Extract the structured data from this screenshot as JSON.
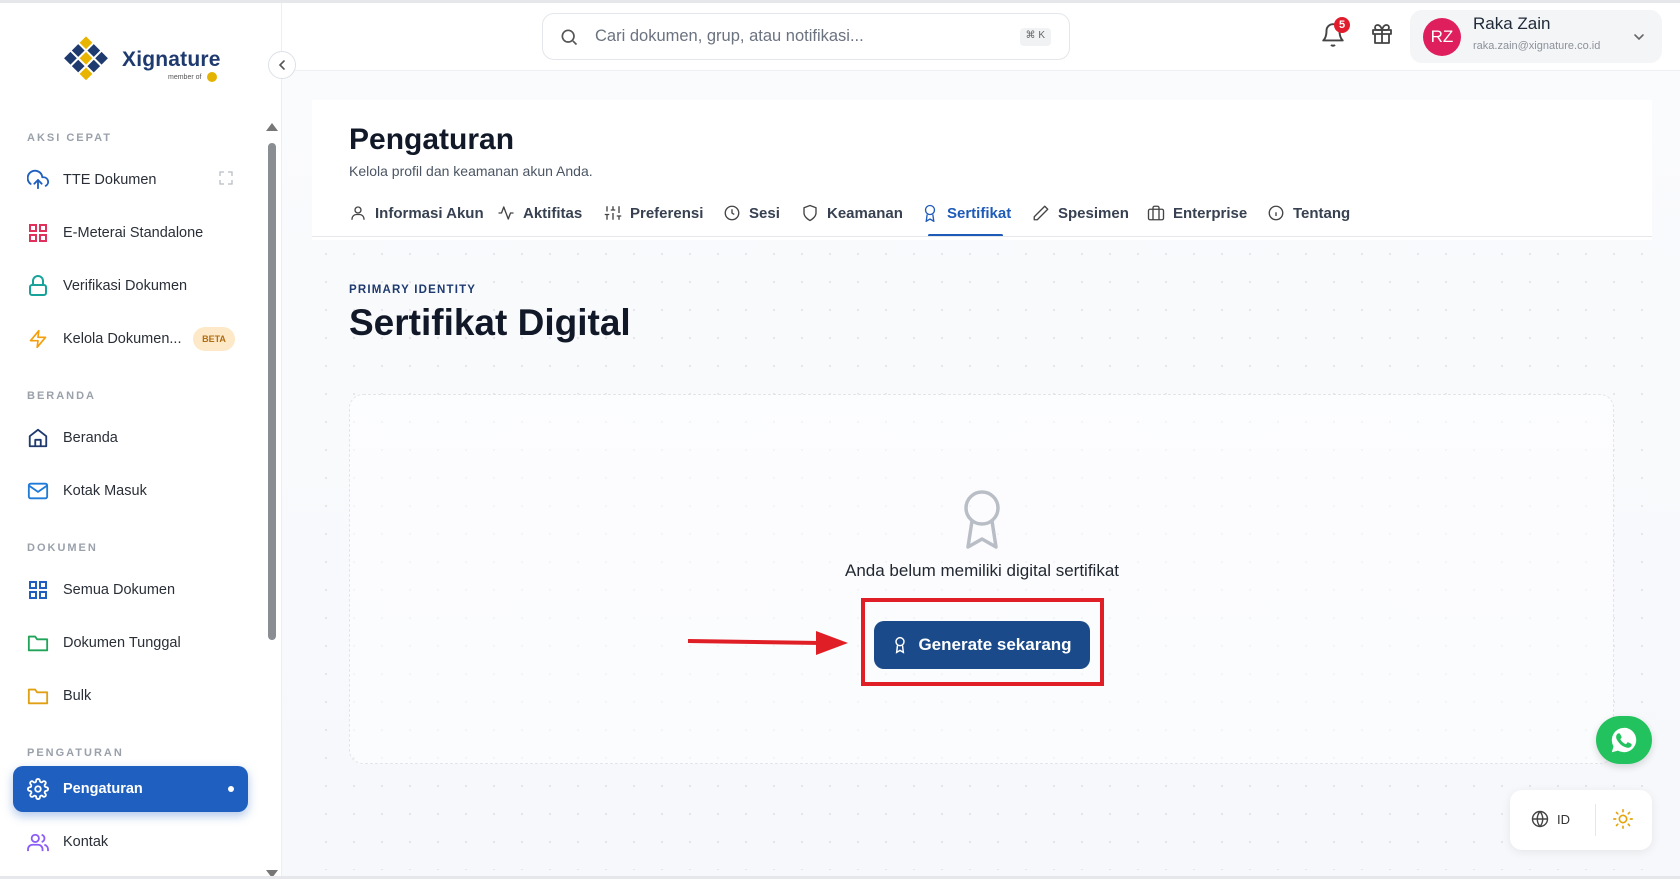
{
  "app": {
    "logo_text": "Xignature",
    "logo_member": "member of"
  },
  "sidebar": {
    "sections": [
      {
        "title": "AKSI CEPAT"
      },
      {
        "title": "BERANDA"
      },
      {
        "title": "DOKUMEN"
      },
      {
        "title": "PENGATURAN"
      }
    ],
    "items": [
      {
        "label": "TTE Dokumen",
        "icon": "upload-cloud-icon",
        "color": "#1f5fbf"
      },
      {
        "label": "E-Meterai Standalone",
        "icon": "grid-icon",
        "color": "#e0315c"
      },
      {
        "label": "Verifikasi Dokumen",
        "icon": "lock-icon",
        "color": "#17a39a"
      },
      {
        "label": "Kelola Dokumen...",
        "icon": "lightning-icon",
        "color": "#f59e0b",
        "badge": "BETA"
      },
      {
        "label": "Beranda",
        "icon": "home-icon",
        "color": "#1e3a6e"
      },
      {
        "label": "Kotak Masuk",
        "icon": "mail-icon",
        "color": "#1f7ad8"
      },
      {
        "label": "Semua Dokumen",
        "icon": "grid-icon",
        "color": "#1f5fbf"
      },
      {
        "label": "Dokumen Tunggal",
        "icon": "folder-icon",
        "color": "#22a35a"
      },
      {
        "label": "Bulk",
        "icon": "folder-icon",
        "color": "#e0a013"
      },
      {
        "label": "Pengaturan",
        "icon": "gear-icon",
        "color": "#ffffff",
        "active": true
      },
      {
        "label": "Kontak",
        "icon": "users-icon",
        "color": "#8b5cf6"
      }
    ]
  },
  "header": {
    "search_placeholder": "Cari dokumen, grup, atau notifikasi...",
    "search_shortcut": "⌘ K",
    "notification_count": "5",
    "user": {
      "initials": "RZ",
      "name": "Raka Zain",
      "email": "raka.zain@xignature.co.id"
    }
  },
  "page": {
    "title": "Pengaturan",
    "subtitle": "Kelola profil dan keamanan akun Anda.",
    "tabs": [
      {
        "label": "Informasi Akun",
        "icon": "user-icon"
      },
      {
        "label": "Aktifitas",
        "icon": "activity-icon"
      },
      {
        "label": "Preferensi",
        "icon": "sliders-icon"
      },
      {
        "label": "Sesi",
        "icon": "clock-icon"
      },
      {
        "label": "Keamanan",
        "icon": "shield-icon"
      },
      {
        "label": "Sertifikat",
        "icon": "award-icon",
        "active": true
      },
      {
        "label": "Spesimen",
        "icon": "pen-icon"
      },
      {
        "label": "Enterprise",
        "icon": "briefcase-icon"
      },
      {
        "label": "Tentang",
        "icon": "info-icon"
      }
    ],
    "section_eyebrow": "PRIMARY IDENTITY",
    "section_title": "Sertifikat Digital",
    "empty_state_text": "Anda belum memiliki digital sertifikat",
    "generate_button": "Generate sekarang"
  },
  "footer_widgets": {
    "language": "ID"
  },
  "colors": {
    "primary": "#1a4a8a",
    "active_nav": "#1f5fbf",
    "highlight": "#e01e26",
    "whatsapp": "#22c35e"
  }
}
